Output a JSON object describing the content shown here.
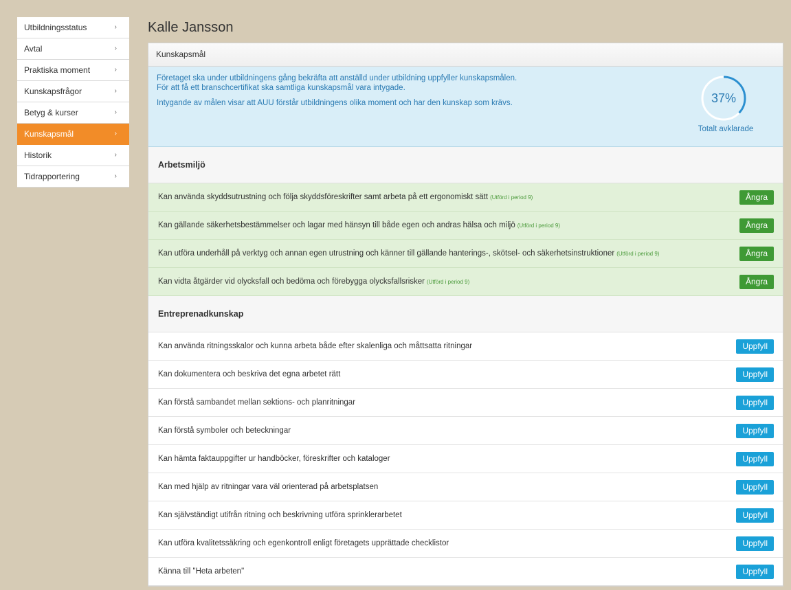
{
  "sidebar": {
    "items": [
      {
        "label": "Utbildningsstatus",
        "active": false
      },
      {
        "label": "Avtal",
        "active": false
      },
      {
        "label": "Praktiska moment",
        "active": false
      },
      {
        "label": "Kunskapsfrågor",
        "active": false
      },
      {
        "label": "Betyg & kurser",
        "active": false
      },
      {
        "label": "Kunskapsmål",
        "active": true
      },
      {
        "label": "Historik",
        "active": false
      },
      {
        "label": "Tidrapportering",
        "active": false
      }
    ],
    "chevron": "›"
  },
  "page": {
    "title": "Kalle Jansson",
    "panel_title": "Kunskapsmål"
  },
  "info": {
    "line1": "Företaget ska under utbildningens gång bekräfta att anställd under utbildning uppfyller kunskapsmålen.",
    "line2": "För att få ett branschcertifikat ska samtliga kunskapsmål vara intygade.",
    "line3": "Intygande av målen visar att AUU förstår utbildningens olika moment och har den kunskap som krävs.",
    "progress_value": 0.37,
    "progress_label": "37%",
    "progress_caption": "Totalt avklarade"
  },
  "sections": [
    {
      "title": "Arbetsmiljö",
      "items": [
        {
          "text": "Kan använda skyddsutrustning och följa skyddsföreskrifter samt arbeta på ett ergonomiskt sätt",
          "done": true,
          "note": "(Utförd i period 9)",
          "button": "Ångra"
        },
        {
          "text": "Kan gällande säkerhetsbestämmelser och lagar med hänsyn till både egen och andras hälsa och miljö",
          "done": true,
          "note": "(Utförd i period 9)",
          "button": "Ångra"
        },
        {
          "text": "Kan utföra underhåll på verktyg och annan egen utrustning och känner till gällande hanterings-, skötsel- och säkerhetsinstruktioner",
          "done": true,
          "note": "(Utförd i period 9)",
          "button": "Ångra"
        },
        {
          "text": "Kan vidta åtgärder vid olycksfall och bedöma och förebygga olycksfallsrisker",
          "done": true,
          "note": "(Utförd i period 9)",
          "button": "Ångra"
        }
      ]
    },
    {
      "title": "Entreprenadkunskap",
      "items": [
        {
          "text": "Kan använda ritningsskalor och kunna arbeta både efter skalenliga och måttsatta ritningar",
          "done": false,
          "note": "",
          "button": "Uppfyll"
        },
        {
          "text": "Kan dokumentera och beskriva det egna arbetet rätt",
          "done": false,
          "note": "",
          "button": "Uppfyll"
        },
        {
          "text": "Kan förstå sambandet mellan sektions- och planritningar",
          "done": false,
          "note": "",
          "button": "Uppfyll"
        },
        {
          "text": "Kan förstå symboler och beteckningar",
          "done": false,
          "note": "",
          "button": "Uppfyll"
        },
        {
          "text": "Kan hämta faktauppgifter ur handböcker, föreskrifter och kataloger",
          "done": false,
          "note": "",
          "button": "Uppfyll"
        },
        {
          "text": "Kan med hjälp av ritningar vara väl orienterad på arbetsplatsen",
          "done": false,
          "note": "",
          "button": "Uppfyll"
        },
        {
          "text": "Kan självständigt utifrån ritning och beskrivning utföra sprinklerarbetet",
          "done": false,
          "note": "",
          "button": "Uppfyll"
        },
        {
          "text": "Kan utföra kvalitetssäkring och egenkontroll enligt företagets upprättade checklistor",
          "done": false,
          "note": "",
          "button": "Uppfyll"
        },
        {
          "text": "Känna till \"Heta arbeten\"",
          "done": false,
          "note": "",
          "button": "Uppfyll"
        }
      ]
    }
  ],
  "colors": {
    "accent_orange": "#f28c28",
    "done_green_bg": "#e2f1d9",
    "undo_button": "#3f9a35",
    "fulfil_button": "#1aa1d8",
    "info_blue": "#2b7bb3",
    "page_bg": "#d6cbb5"
  }
}
